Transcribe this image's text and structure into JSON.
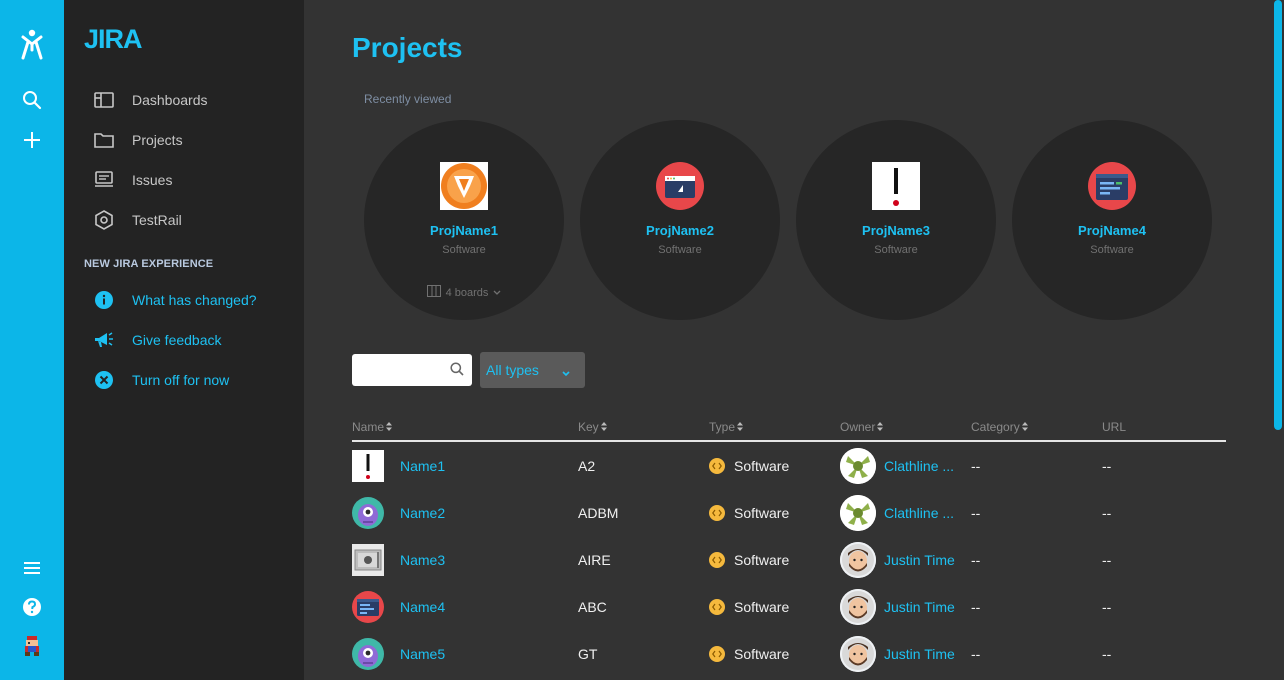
{
  "app": {
    "logo": "JIRA"
  },
  "sidebar": {
    "items": [
      {
        "label": "Dashboards",
        "icon": "dashboard-icon"
      },
      {
        "label": "Projects",
        "icon": "folder-icon"
      },
      {
        "label": "Issues",
        "icon": "issues-icon"
      },
      {
        "label": "TestRail",
        "icon": "testrail-icon"
      }
    ],
    "section_title": "NEW JIRA EXPERIENCE",
    "experience_items": [
      {
        "label": "What has changed?",
        "icon": "info-icon"
      },
      {
        "label": "Give feedback",
        "icon": "megaphone-icon"
      },
      {
        "label": "Turn off for now",
        "icon": "close-icon"
      }
    ]
  },
  "main": {
    "title": "Projects",
    "recent_label": "Recently viewed",
    "recent": [
      {
        "name": "ProjName1",
        "type": "Software",
        "boards": "4 boards"
      },
      {
        "name": "ProjName2",
        "type": "Software"
      },
      {
        "name": "ProjName3",
        "type": "Software"
      },
      {
        "name": "ProjName4",
        "type": "Software"
      }
    ],
    "search": {
      "value": "",
      "placeholder": ""
    },
    "type_filter": {
      "value": "All types"
    },
    "columns": [
      "Name",
      "Key",
      "Type",
      "Owner",
      "Category",
      "URL"
    ],
    "rows": [
      {
        "name": "Name1",
        "key": "A2",
        "type": "Software",
        "owner": "Clathline ...",
        "category": "--",
        "url": "--"
      },
      {
        "name": "Name2",
        "key": "ADBM",
        "type": "Software",
        "owner": "Clathline ...",
        "category": "--",
        "url": "--"
      },
      {
        "name": "Name3",
        "key": "AIRE",
        "type": "Software",
        "owner": "Justin Time",
        "category": "--",
        "url": "--"
      },
      {
        "name": "Name4",
        "key": "ABC",
        "type": "Software",
        "owner": "Justin Time",
        "category": "--",
        "url": "--"
      },
      {
        "name": "Name5",
        "key": "GT",
        "type": "Software",
        "owner": "Justin Time",
        "category": "--",
        "url": "--"
      }
    ]
  },
  "colors": {
    "accent": "#1ec1f2",
    "rail": "#0cb6e8",
    "sidebar": "#232323",
    "background": "#333333"
  }
}
